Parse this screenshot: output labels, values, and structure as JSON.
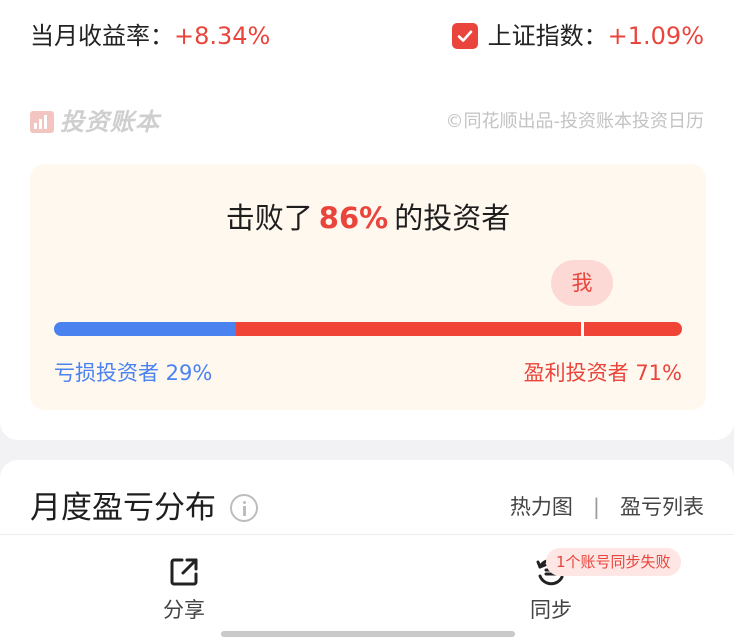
{
  "stats": {
    "monthly_return_label": "当月收益率：",
    "monthly_return_value": "+8.34%",
    "index_checked": true,
    "index_label": "上证指数：",
    "index_value": "+1.09%"
  },
  "brand": {
    "name": "投资账本",
    "copyright": "©同花顺出品-投资账本投资日历"
  },
  "beat": {
    "prefix": "击败了",
    "percent": "86%",
    "suffix": "的投资者",
    "me_label": "我",
    "me_position": 0.84,
    "loss_share": 0.29,
    "loss_label": "亏损投资者 29%",
    "gain_label": "盈利投资者 71%"
  },
  "section": {
    "title": "月度盈亏分布",
    "tab_heatmap": "热力图",
    "separator": "|",
    "tab_list": "盈亏列表"
  },
  "actions": {
    "share_label": "分享",
    "sync_label": "同步",
    "sync_badge": "1个账号同步失败"
  },
  "colors": {
    "accent_red": "#e9453d",
    "loss_blue": "#4a82f0",
    "gain_red": "#f04436"
  }
}
